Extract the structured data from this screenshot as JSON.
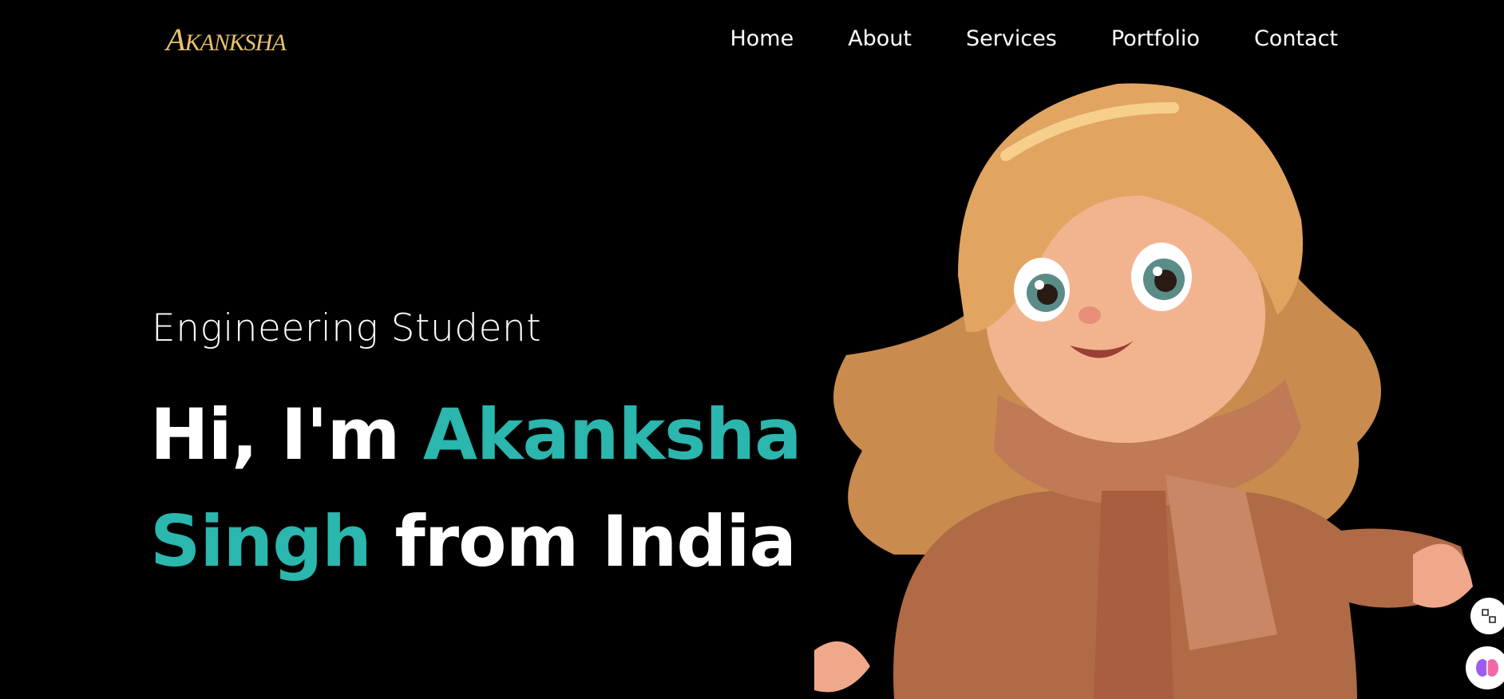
{
  "header": {
    "logo_initial": "A",
    "logo_rest": "KANKSHA",
    "nav": [
      "Home",
      "About",
      "Services",
      "Portfolio",
      "Contact"
    ]
  },
  "hero": {
    "subtitle": "Engineering Student",
    "greeting": "Hi, I'm ",
    "name_first": "Akanksha",
    "name_last": "Singh",
    "suffix": " from India"
  },
  "colors": {
    "accent": "#2bb6ae",
    "logo": "#e7c26a",
    "background": "#000000"
  },
  "icons": {
    "translate": "translate-icon",
    "ai": "brain-icon"
  }
}
